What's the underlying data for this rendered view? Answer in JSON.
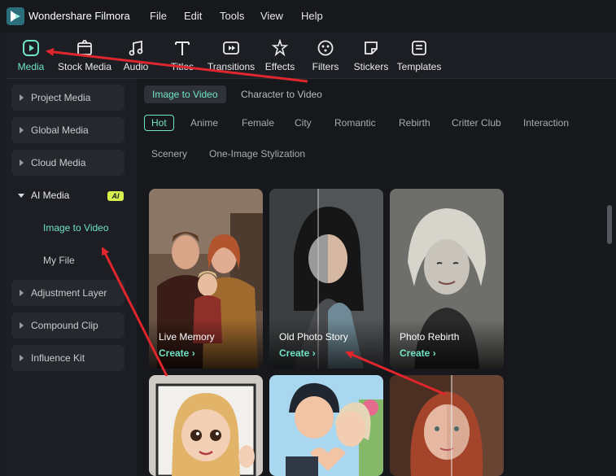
{
  "app": {
    "title": "Wondershare Filmora"
  },
  "menu": [
    "File",
    "Edit",
    "Tools",
    "View",
    "Help"
  ],
  "toolbar": {
    "items": [
      "Media",
      "Stock Media",
      "Audio",
      "Titles",
      "Transitions",
      "Effects",
      "Filters",
      "Stickers",
      "Templates"
    ],
    "active": "Media"
  },
  "sidebar": {
    "items": [
      "Project Media",
      "Global Media",
      "Cloud Media",
      "AI Media",
      "Adjustment Layer",
      "Compound Clip",
      "Influence Kit"
    ],
    "ai_badge": "AI",
    "ai_subitems": [
      "Image to Video",
      "My File"
    ],
    "active_subitem": "Image to Video"
  },
  "content": {
    "modes": [
      "Image to Video",
      "Character to Video"
    ],
    "active_mode": "Image to Video",
    "categories": [
      "Hot",
      "Anime",
      "Female",
      "City",
      "Romantic",
      "Rebirth",
      "Critter Club",
      "Interaction",
      "Scenery",
      "One-Image Stylization"
    ],
    "active_category": "Hot",
    "cards": [
      {
        "title": "Live Memory",
        "action": "Create"
      },
      {
        "title": "Old Photo Story",
        "action": "Create"
      },
      {
        "title": "Photo Rebirth",
        "action": "Create"
      }
    ]
  },
  "colors": {
    "accent": "#6fe3c6",
    "annotation": "#e0262d",
    "ai_badge": "#d6f04c"
  }
}
